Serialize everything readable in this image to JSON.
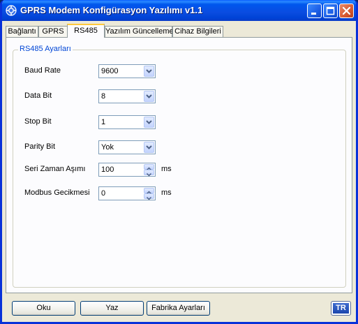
{
  "window": {
    "title": "GPRS Modem Konfigürasyon Yazılımı v1.1",
    "icon": "modem-gear-icon"
  },
  "titlebar_buttons": [
    "minimize-icon",
    "maximize-icon",
    "close-icon"
  ],
  "tabs": [
    {
      "label": "Bağlantı",
      "active": false
    },
    {
      "label": "GPRS",
      "active": false
    },
    {
      "label": "RS485",
      "active": true
    },
    {
      "label": "Yazılım Güncelleme",
      "active": false
    },
    {
      "label": "Cihaz Bilgileri",
      "active": false
    }
  ],
  "rs485": {
    "group_title": "RS485 Ayarları",
    "baud_rate": {
      "label": "Baud Rate",
      "value": "9600"
    },
    "data_bit": {
      "label": "Data Bit",
      "value": "8"
    },
    "stop_bit": {
      "label": "Stop Bit",
      "value": "1"
    },
    "parity_bit": {
      "label": "Parity Bit",
      "value": "Yok"
    },
    "serial_timeout": {
      "label": "Seri Zaman Aşımı",
      "value": "100",
      "unit": "ms"
    },
    "modbus_delay": {
      "label": "Modbus Gecikmesi",
      "value": "0",
      "unit": "ms"
    }
  },
  "footer": {
    "read_label": "Oku",
    "write_label": "Yaz",
    "factory_label": "Fabrika Ayarları",
    "language_label": "TR"
  },
  "colors": {
    "titlebar": "#0058ee",
    "group_title": "#0046d5",
    "active_tab_accent": "#ffc83c"
  }
}
